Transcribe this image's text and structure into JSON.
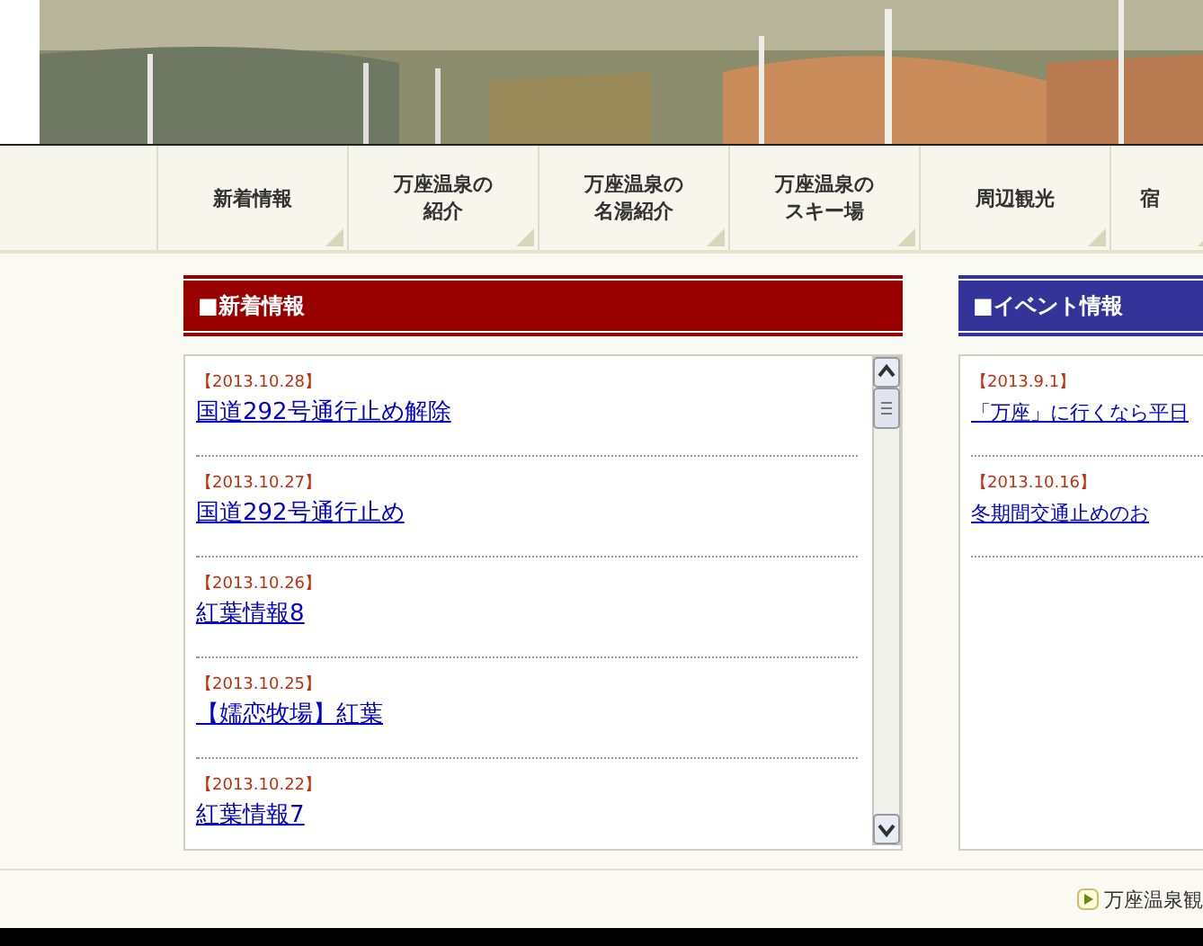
{
  "nav": [
    {
      "label": "新着情報"
    },
    {
      "label": "万座温泉の紹介"
    },
    {
      "label": "万座温泉の名湯紹介"
    },
    {
      "label": "万座温泉のスキー場"
    },
    {
      "label": "周辺観光"
    },
    {
      "label": "宿"
    }
  ],
  "news": {
    "title": "■新着情報",
    "items": [
      {
        "date": "【2013.10.28】",
        "title": "国道292号通行止め解除"
      },
      {
        "date": "【2013.10.27】",
        "title": "国道292号通行止め"
      },
      {
        "date": "【2013.10.26】",
        "title": "紅葉情報8"
      },
      {
        "date": "【2013.10.25】",
        "title": "【嬬恋牧場】紅葉"
      },
      {
        "date": "【2013.10.22】",
        "title": "紅葉情報7"
      }
    ]
  },
  "events": {
    "title": "■イベント情報",
    "items": [
      {
        "date": "【2013.9.1】",
        "title": "「万座」に行くなら平日"
      },
      {
        "date": "【2013.10.16】",
        "title": "冬期間交通止めのお"
      }
    ]
  },
  "footer": {
    "link": "万座温泉観"
  }
}
